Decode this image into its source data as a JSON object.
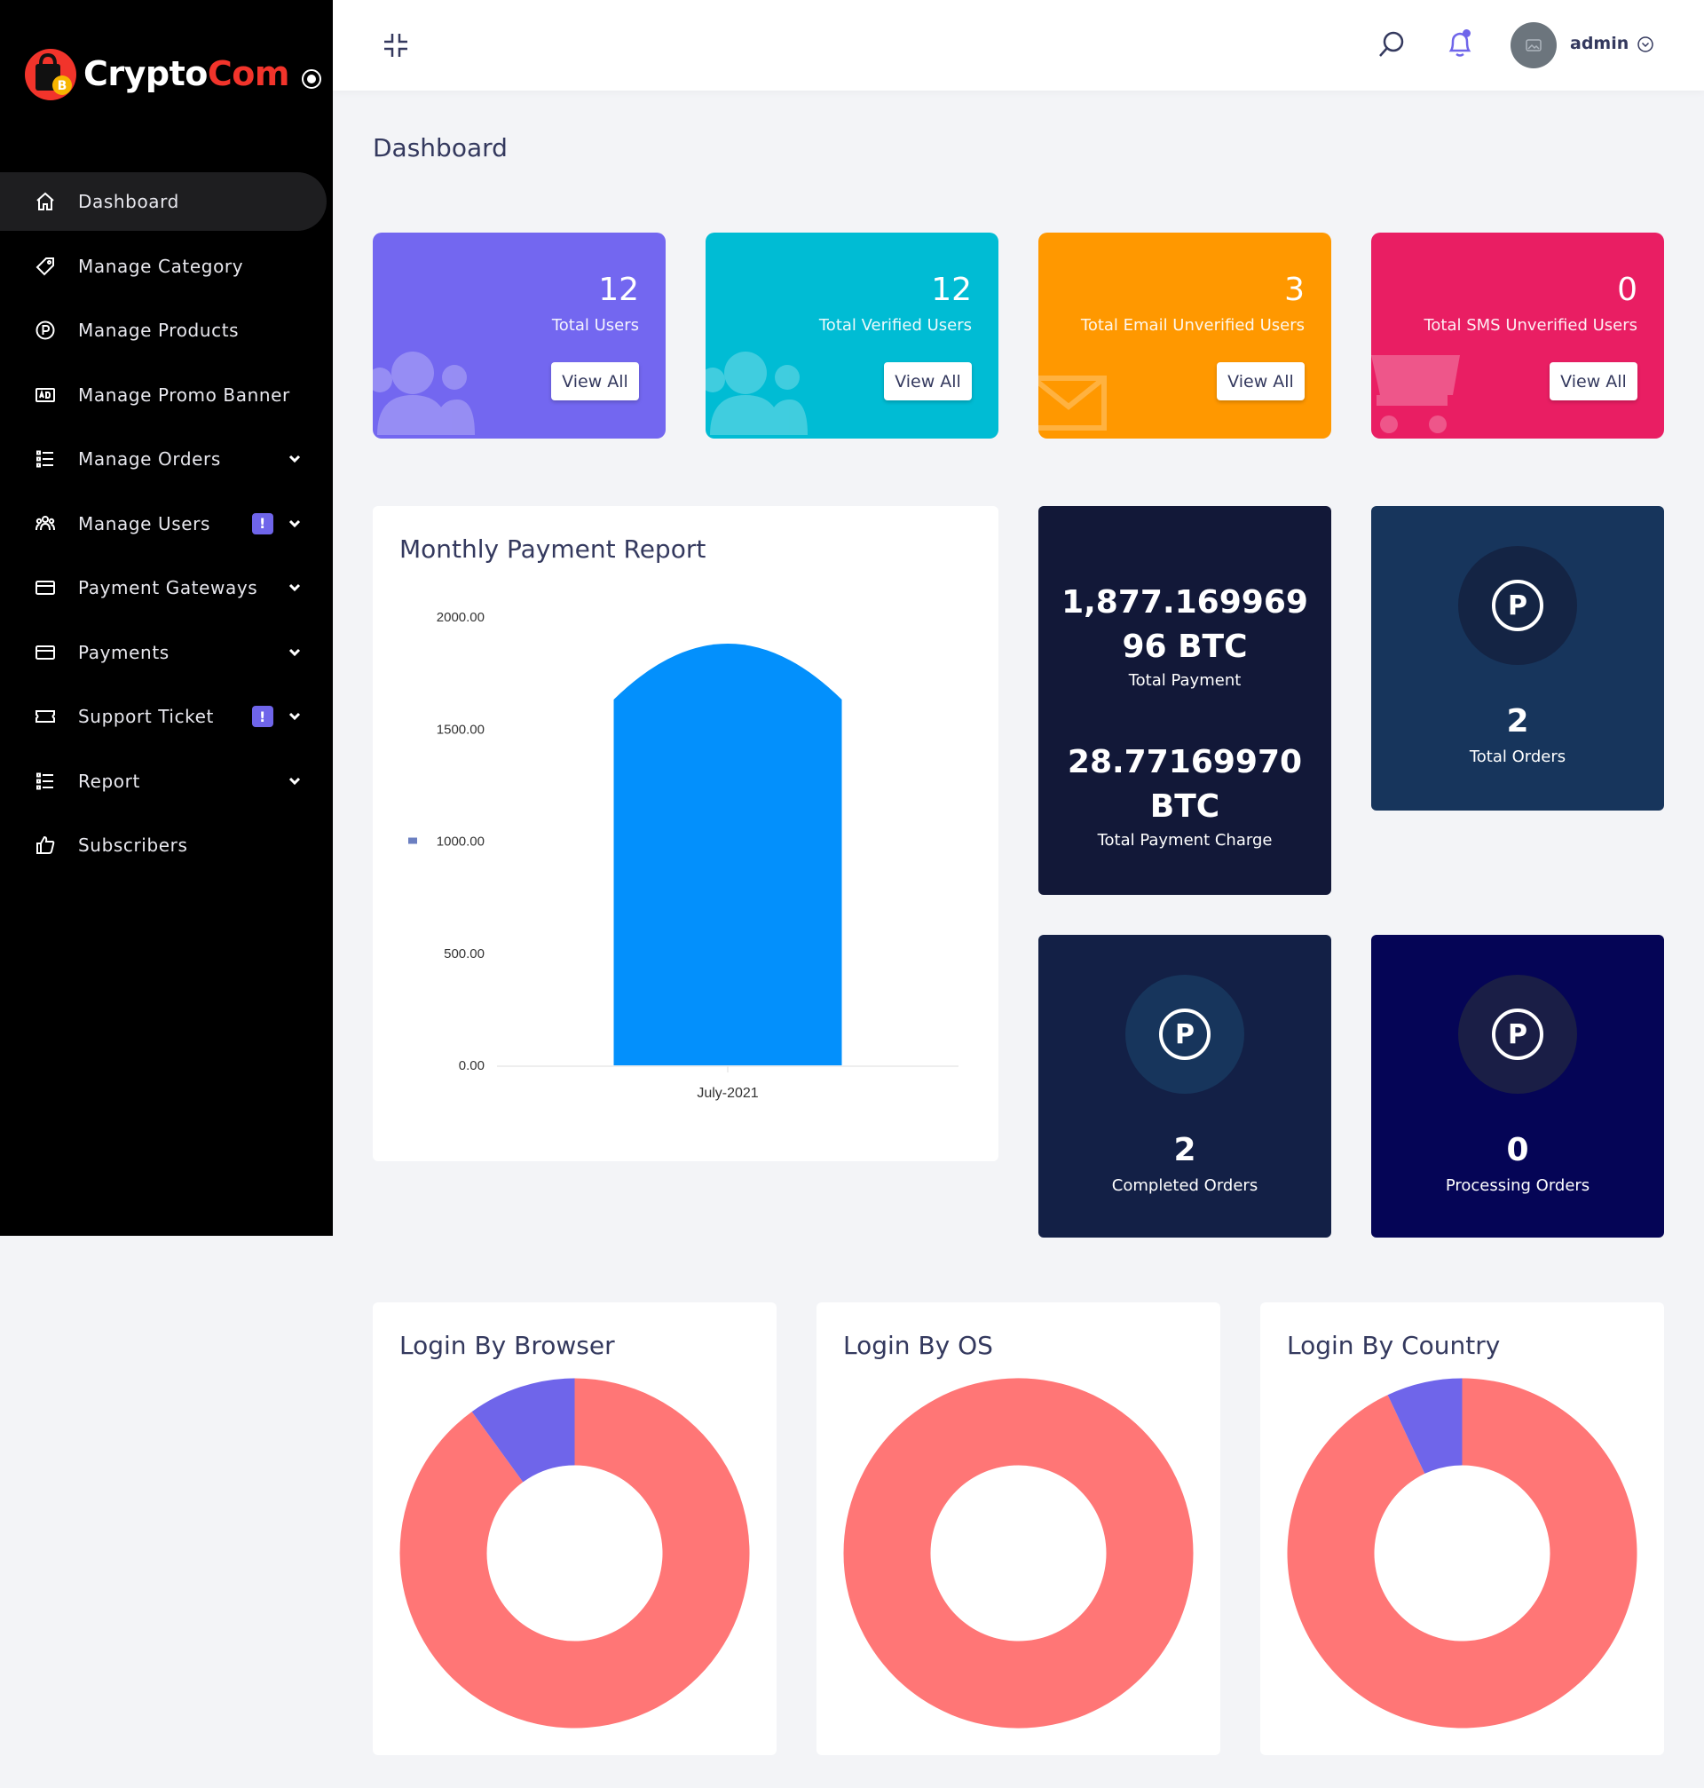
{
  "brand": {
    "name_part1": "Crypto",
    "name_part2": "Com"
  },
  "sidebar": {
    "items": [
      {
        "label": "Dashboard",
        "icon": "home-icon",
        "active": true
      },
      {
        "label": "Manage Category",
        "icon": "tag-icon"
      },
      {
        "label": "Manage Products",
        "icon": "p-circle-icon"
      },
      {
        "label": "Manage Promo Banner",
        "icon": "ad-icon"
      },
      {
        "label": "Manage Orders",
        "icon": "list-icon",
        "dropdown": true
      },
      {
        "label": "Manage Users",
        "icon": "users-icon",
        "badge": "!",
        "dropdown": true
      },
      {
        "label": "Payment Gateways",
        "icon": "card-icon",
        "dropdown": true
      },
      {
        "label": "Payments",
        "icon": "card-icon",
        "dropdown": true
      },
      {
        "label": "Support Ticket",
        "icon": "ticket-icon",
        "badge": "!",
        "dropdown": true
      },
      {
        "label": "Report",
        "icon": "list-icon",
        "dropdown": true
      },
      {
        "label": "Subscribers",
        "icon": "thumbs-up-icon"
      }
    ]
  },
  "header": {
    "user_name": "admin"
  },
  "page_title": "Dashboard",
  "stats": [
    {
      "value": "12",
      "label": "Total Users",
      "button": "View All",
      "color": "#7367f0"
    },
    {
      "value": "12",
      "label": "Total Verified Users",
      "button": "View All",
      "color": "#00bcd4"
    },
    {
      "value": "3",
      "label": "Total Email Unverified Users",
      "button": "View All",
      "color": "#ff9800"
    },
    {
      "value": "0",
      "label": "Total SMS Unverified Users",
      "button": "View All",
      "color": "#e91e63"
    }
  ],
  "payment": {
    "total_payment_line1": "1,877.169969",
    "total_payment_line2": "96 BTC",
    "total_payment_label": "Total Payment",
    "charge_line1": "28.77169970",
    "charge_line2": "BTC",
    "charge_label": "Total Payment Charge"
  },
  "orders": {
    "total": {
      "value": "2",
      "label": "Total Orders"
    },
    "completed": {
      "value": "2",
      "label": "Completed Orders"
    },
    "processing": {
      "value": "0",
      "label": "Processing Orders"
    }
  },
  "colors": {
    "bar": "#0390fc",
    "donut_main": "#ff7676",
    "donut_secondary": "#6f65ea",
    "dark_navy": "#121838",
    "dark_blue": "#17355c",
    "deep_blue": "#050556"
  },
  "chart_data": {
    "type": "bar",
    "title": "Monthly Payment Report",
    "categories": [
      "July-2021"
    ],
    "values": [
      1877.17
    ],
    "ylim": [
      0,
      2000
    ],
    "yticks": [
      "2000.00",
      "1500.00",
      "1000.00",
      "500.00",
      "0.00"
    ],
    "grid": false
  },
  "donuts": [
    {
      "title": "Login By Browser",
      "slices": [
        0.9,
        0.1
      ]
    },
    {
      "title": "Login By OS",
      "slices": [
        1.0,
        0.0
      ]
    },
    {
      "title": "Login By Country",
      "slices": [
        0.93,
        0.07
      ]
    }
  ]
}
